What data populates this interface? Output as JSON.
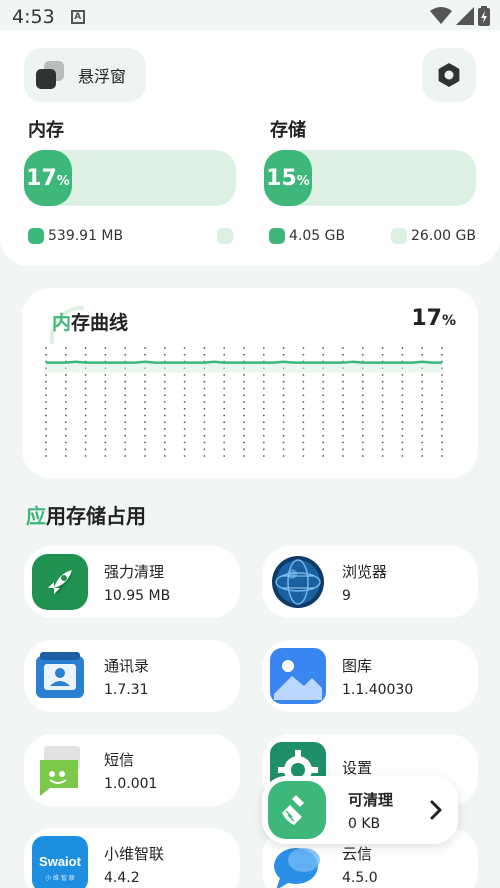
{
  "status": {
    "time": "4:53",
    "notif": "A"
  },
  "header": {
    "float_window_label": "悬浮窗"
  },
  "memory": {
    "label": "内存",
    "percent": 17,
    "percent_text": "17",
    "pct_sign": "%",
    "used": "539.91 MB",
    "free": ""
  },
  "storage": {
    "label": "存储",
    "percent": 15,
    "percent_text": "15",
    "pct_sign": "%",
    "used": "4.05 GB",
    "total": "26.00 GB"
  },
  "curve": {
    "title_head": "内",
    "title_tail": "存曲线",
    "value": "17",
    "pct_sign": "%"
  },
  "apps": {
    "title_head": "应",
    "title_tail": "用存储占用",
    "items": [
      {
        "name": "强力清理",
        "value": "10.95 MB",
        "icon": "rocket-icon"
      },
      {
        "name": "浏览器",
        "value": "9",
        "icon": "globe-icon"
      },
      {
        "name": "通讯录",
        "value": "1.7.31",
        "icon": "contacts-icon"
      },
      {
        "name": "图库",
        "value": "1.1.40030",
        "icon": "gallery-icon"
      },
      {
        "name": "短信",
        "value": "1.0.001",
        "icon": "sms-icon"
      },
      {
        "name": "设置",
        "value": "",
        "icon": "gear-icon"
      },
      {
        "name": "小维智联",
        "value": "4.4.2",
        "icon": "swaiot-icon",
        "logo_text": "Swaiot",
        "logo_sub": "小 维 智 联"
      },
      {
        "name": "云信",
        "value": "4.5.0",
        "icon": "chat-icon"
      }
    ]
  },
  "cleanable": {
    "label": "可清理",
    "value": "0 KB"
  },
  "colors": {
    "accent": "#3db77a",
    "accent_light": "#dcf1e4",
    "background": "#f1f5f3"
  }
}
